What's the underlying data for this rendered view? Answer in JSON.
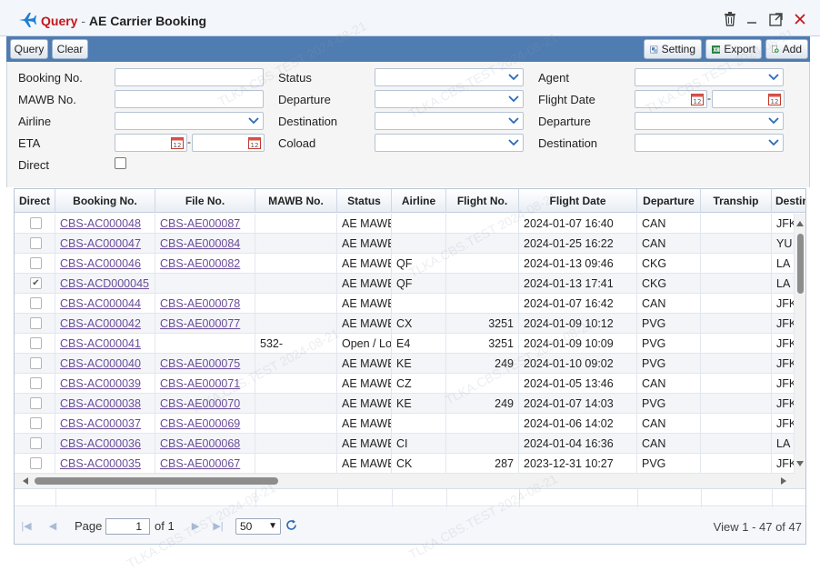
{
  "window": {
    "title_query": "Query",
    "title_separator": " - ",
    "title_name": "AE Carrier Booking"
  },
  "toolbar": {
    "query_label": "Query",
    "clear_label": "Clear",
    "setting_label": "Setting",
    "export_label": "Export",
    "add_label": "Add"
  },
  "filters": {
    "booking_no": "Booking No.",
    "mawb_no": "MAWB No.",
    "airline": "Airline",
    "eta": "ETA",
    "direct": "Direct",
    "status": "Status",
    "departure": "Departure",
    "destination": "Destination",
    "coload": "Coload",
    "agent": "Agent",
    "flight_date": "Flight Date",
    "departure2": "Departure",
    "destination2": "Destination"
  },
  "grid": {
    "columns": [
      "Direct",
      "Booking No.",
      "File No.",
      "MAWB No.",
      "Status",
      "Airline",
      "Flight No.",
      "Flight Date",
      "Departure",
      "Tranship",
      "Destin"
    ],
    "rows": [
      {
        "direct": false,
        "booking": "CBS-AC000048",
        "file": "CBS-AE000087",
        "mawb": "",
        "status": "AE MAWE",
        "airline": "",
        "flight_no": "",
        "flight_date": "2024-01-07 16:40",
        "departure": "CAN",
        "tranship": "",
        "destination": "JFK"
      },
      {
        "direct": false,
        "booking": "CBS-AC000047",
        "file": "CBS-AE000084",
        "mawb": "",
        "status": "AE MAWE",
        "airline": "",
        "flight_no": "",
        "flight_date": "2024-01-25 16:22",
        "departure": "CAN",
        "tranship": "",
        "destination": "YU"
      },
      {
        "direct": false,
        "booking": "CBS-AC000046",
        "file": "CBS-AE000082",
        "mawb": "",
        "status": "AE MAWE",
        "airline": "QF",
        "flight_no": "",
        "flight_date": "2024-01-13 09:46",
        "departure": "CKG",
        "tranship": "",
        "destination": "LA"
      },
      {
        "direct": true,
        "booking": "CBS-ACD000045",
        "file": "",
        "mawb": "",
        "status": "AE MAWE",
        "airline": "QF",
        "flight_no": "",
        "flight_date": "2024-01-13 17:41",
        "departure": "CKG",
        "tranship": "",
        "destination": "LA"
      },
      {
        "direct": false,
        "booking": "CBS-AC000044",
        "file": "CBS-AE000078",
        "mawb": "",
        "status": "AE MAWE",
        "airline": "",
        "flight_no": "",
        "flight_date": "2024-01-07 16:42",
        "departure": "CAN",
        "tranship": "",
        "destination": "JFK"
      },
      {
        "direct": false,
        "booking": "CBS-AC000042",
        "file": "CBS-AE000077",
        "mawb": "",
        "status": "AE MAWE",
        "airline": "CX",
        "flight_no": "3251",
        "flight_date": "2024-01-09 10:12",
        "departure": "PVG",
        "tranship": "",
        "destination": "JFK"
      },
      {
        "direct": false,
        "booking": "CBS-AC000041",
        "file": "",
        "mawb": "532-",
        "status": "Open / Lo",
        "airline": "E4",
        "flight_no": "3251",
        "flight_date": "2024-01-09 10:09",
        "departure": "PVG",
        "tranship": "",
        "destination": "JFK"
      },
      {
        "direct": false,
        "booking": "CBS-AC000040",
        "file": "CBS-AE000075",
        "mawb": "",
        "status": "AE MAWE",
        "airline": "KE",
        "flight_no": "249",
        "flight_date": "2024-01-10 09:02",
        "departure": "PVG",
        "tranship": "",
        "destination": "JFK"
      },
      {
        "direct": false,
        "booking": "CBS-AC000039",
        "file": "CBS-AE000071",
        "mawb": "",
        "status": "AE MAWE",
        "airline": "CZ",
        "flight_no": "",
        "flight_date": "2024-01-05 13:46",
        "departure": "CAN",
        "tranship": "",
        "destination": "JFK"
      },
      {
        "direct": false,
        "booking": "CBS-AC000038",
        "file": "CBS-AE000070",
        "mawb": "",
        "status": "AE MAWE",
        "airline": "KE",
        "flight_no": "249",
        "flight_date": "2024-01-07 14:03",
        "departure": "PVG",
        "tranship": "",
        "destination": "JFK"
      },
      {
        "direct": false,
        "booking": "CBS-AC000037",
        "file": "CBS-AE000069",
        "mawb": "",
        "status": "AE MAWE",
        "airline": "",
        "flight_no": "",
        "flight_date": "2024-01-06 14:02",
        "departure": "CAN",
        "tranship": "",
        "destination": "JFK"
      },
      {
        "direct": false,
        "booking": "CBS-AC000036",
        "file": "CBS-AE000068",
        "mawb": "",
        "status": "AE MAWE",
        "airline": "CI",
        "flight_no": "",
        "flight_date": "2024-01-04 16:36",
        "departure": "CAN",
        "tranship": "",
        "destination": "LA"
      },
      {
        "direct": false,
        "booking": "CBS-AC000035",
        "file": "CBS-AE000067",
        "mawb": "",
        "status": "AE MAWE",
        "airline": "CK",
        "flight_no": "287",
        "flight_date": "2023-12-31 10:27",
        "departure": "PVG",
        "tranship": "",
        "destination": "JFK"
      }
    ]
  },
  "pager": {
    "page_label": "Page",
    "page_value": "1",
    "of_label": "of 1",
    "page_size": "50",
    "view_text": "View 1 - 47 of 47"
  },
  "watermark": "TLKA.CBS.TEST 2024-08-21",
  "colors": {
    "toolbar_bg": "#4f7cb1",
    "title_accent": "#c4161c",
    "link": "#6a4b9a"
  }
}
